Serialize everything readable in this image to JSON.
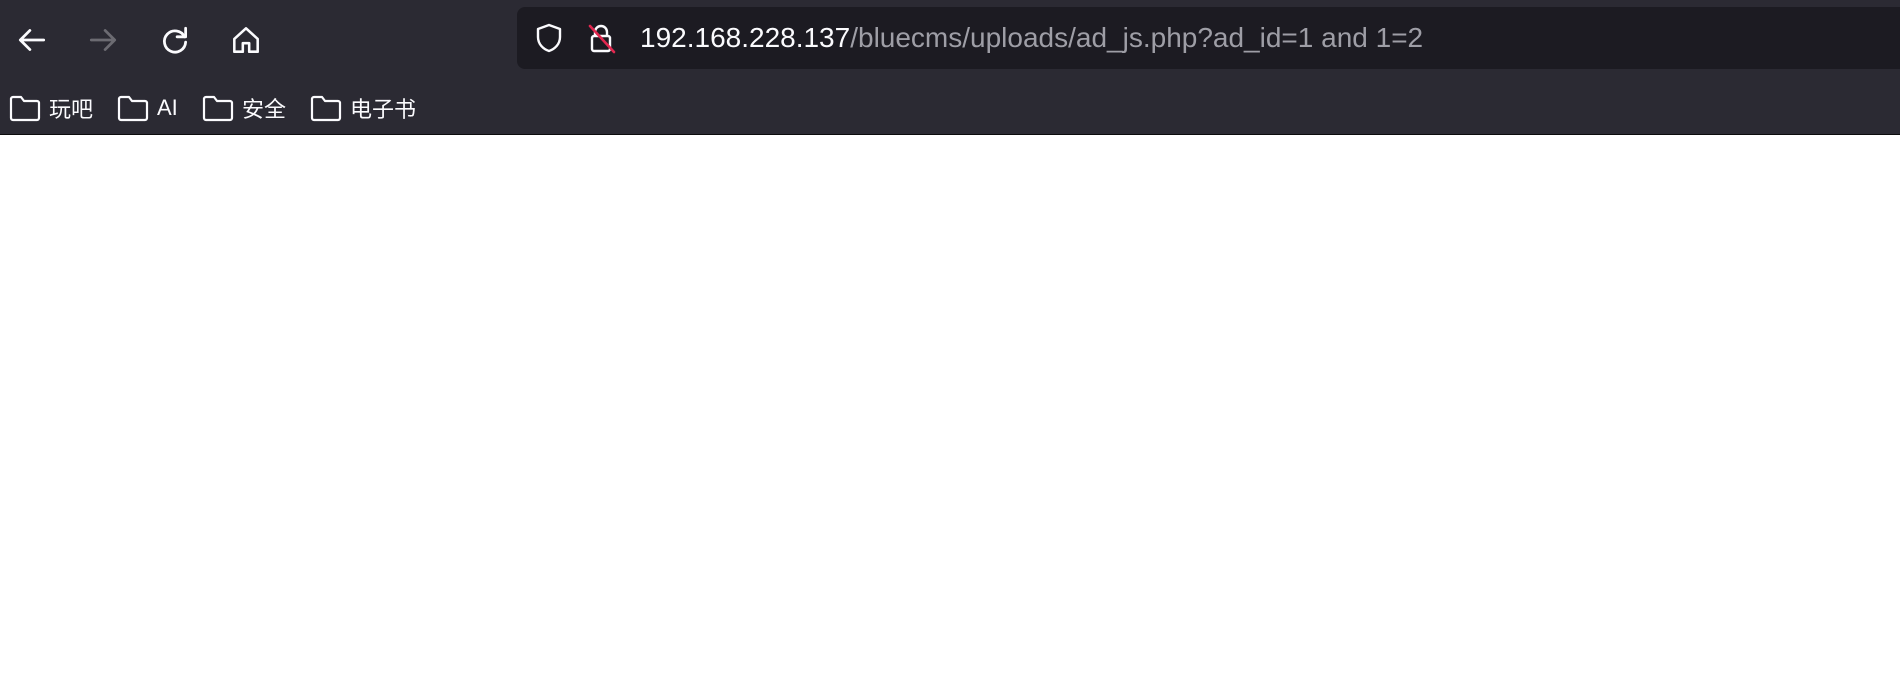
{
  "toolbar": {
    "back_icon": "back-arrow-icon",
    "forward_icon": "forward-arrow-icon",
    "reload_icon": "reload-icon",
    "home_icon": "home-icon"
  },
  "urlbar": {
    "tracking_icon": "shield-icon",
    "security_icon": "insecure-lock-icon",
    "host": "192.168.228.137",
    "path": "/bluecms/uploads/ad_js.php?ad_id=1 and 1=2",
    "accent_insecure": "#e22850"
  },
  "bookmarks": {
    "items": [
      {
        "label": "玩吧",
        "icon": "folder-icon"
      },
      {
        "label": "AI",
        "icon": "folder-icon"
      },
      {
        "label": "安全",
        "icon": "folder-icon"
      },
      {
        "label": "电子书",
        "icon": "folder-icon"
      }
    ]
  },
  "page": {
    "content": ""
  }
}
